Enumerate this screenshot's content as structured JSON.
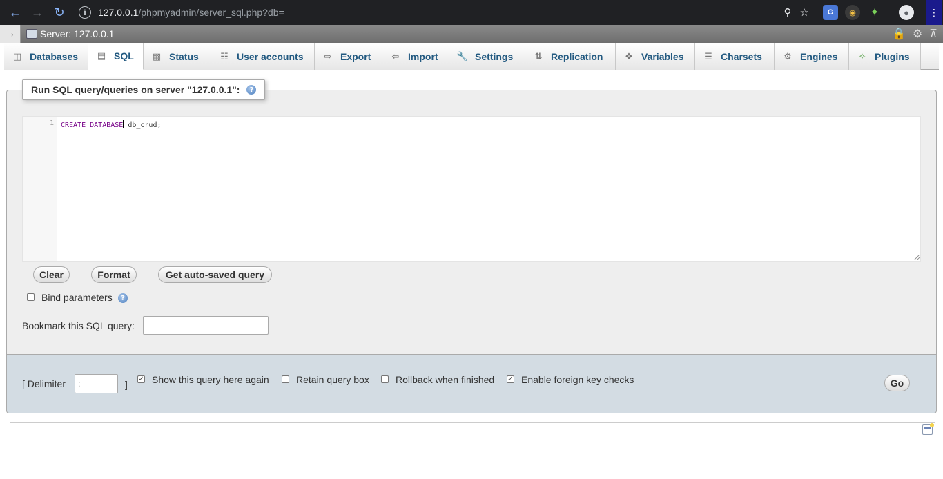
{
  "browser": {
    "url_host": "127.0.0.1",
    "url_path": "/phpmyadmin/server_sql.php?db="
  },
  "server_bar": {
    "label": "Server: 127.0.0.1"
  },
  "tabs": [
    {
      "label": "Databases",
      "icon": "database-icon"
    },
    {
      "label": "SQL",
      "icon": "sql-icon"
    },
    {
      "label": "Status",
      "icon": "status-icon"
    },
    {
      "label": "User accounts",
      "icon": "user-accounts-icon"
    },
    {
      "label": "Export",
      "icon": "export-icon"
    },
    {
      "label": "Import",
      "icon": "import-icon"
    },
    {
      "label": "Settings",
      "icon": "wrench-icon"
    },
    {
      "label": "Replication",
      "icon": "replication-icon"
    },
    {
      "label": "Variables",
      "icon": "variables-icon"
    },
    {
      "label": "Charsets",
      "icon": "charsets-icon"
    },
    {
      "label": "Engines",
      "icon": "engines-icon"
    },
    {
      "label": "Plugins",
      "icon": "puzzle-icon"
    }
  ],
  "sql_panel": {
    "legend": "Run SQL query/queries on server \"127.0.0.1\":",
    "line_number": "1",
    "code_keyword": "CREATE DATABASE",
    "code_rest": " db_crud;",
    "clear_label": "Clear",
    "format_label": "Format",
    "autosaved_label": "Get auto-saved query",
    "bind_parameters_label": "Bind parameters",
    "bind_parameters_checked": false,
    "bookmark_label": "Bookmark this SQL query:",
    "bookmark_value": ""
  },
  "options": {
    "delimiter_label": "[ Delimiter",
    "delimiter_value": ";",
    "delimiter_close": "]",
    "show_query_label": "Show this query here again",
    "show_query_checked": true,
    "retain_label": "Retain query box",
    "retain_checked": false,
    "rollback_label": "Rollback when finished",
    "rollback_checked": false,
    "fk_label": "Enable foreign key checks",
    "fk_checked": true,
    "go_label": "Go"
  }
}
